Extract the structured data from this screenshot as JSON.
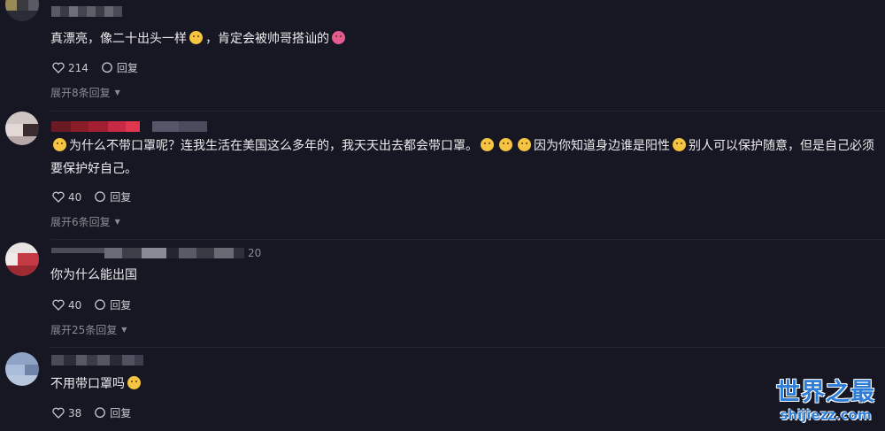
{
  "comments": [
    {
      "text_before": "真漂亮，像二十出头一样",
      "text_after": "，肯定会被帅哥搭讪的",
      "likes": "214",
      "reply_label": "回复",
      "expand_label": "展开8条回复",
      "timestamp": ""
    },
    {
      "text_parts": [
        "为什么不带口罩呢？连我生活在美国这么多年的，我天天出去都会带口罩。",
        "因为你知道身边谁是阳性",
        "别人可以保护随意，但是自己必须要保护好自己。"
      ],
      "likes": "40",
      "reply_label": "回复",
      "expand_label": "展开6条回复"
    },
    {
      "text": "你为什么能出国",
      "timestamp": "20",
      "likes": "40",
      "reply_label": "回复",
      "expand_label": "展开25条回复"
    },
    {
      "text": "不用带口罩吗",
      "likes": "38",
      "reply_label": "回复"
    }
  ],
  "watermark": {
    "title": "世界之最",
    "domain": "shijiezz.com"
  },
  "colors": {
    "background": "#161722",
    "accent": "#2e7ed8",
    "muted": "#8a8b93"
  },
  "icons": {
    "like": "heart-outline-icon",
    "reply": "speech-bubble-icon",
    "expand": "chevron-down-icon"
  }
}
